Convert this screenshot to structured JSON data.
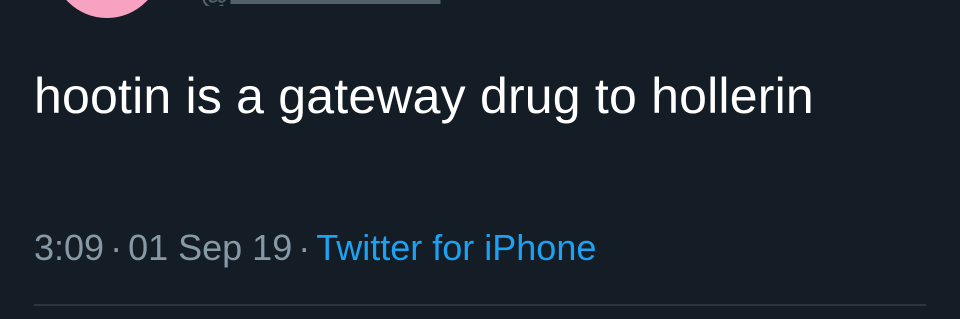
{
  "tweet": {
    "text": "hootin is a gateway drug to hollerin",
    "time": "3:09",
    "date": "01 Sep 19",
    "separator": "·",
    "source": "Twitter for iPhone"
  },
  "colors": {
    "background": "#141d26",
    "text": "#ffffff",
    "meta": "#8899a6",
    "link": "#1da1f2",
    "avatar": "#f6a2c0"
  }
}
